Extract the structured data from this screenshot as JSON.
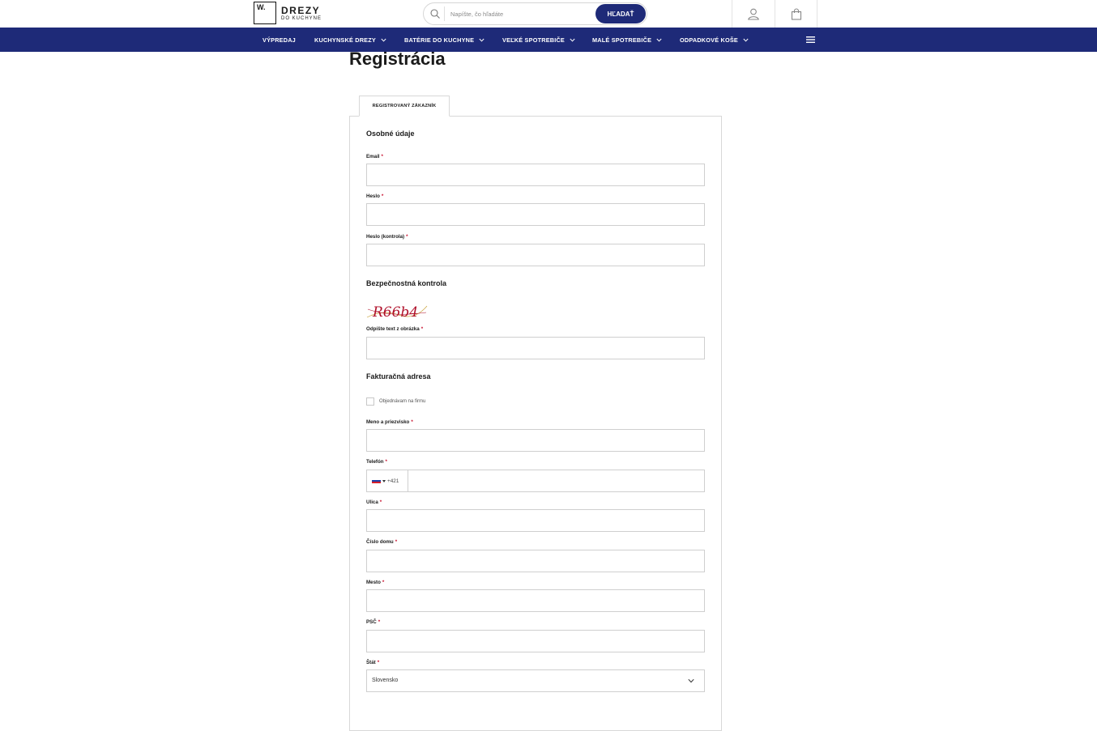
{
  "header": {
    "logo": {
      "mark": "W.",
      "main": "DREZY",
      "sub": "DO KUCHYNE"
    },
    "search": {
      "placeholder": "Napíšte, čo hľadáte",
      "button": "HĽADAŤ"
    },
    "icons": {
      "account": "user-icon",
      "cart": "shopping-bag-icon"
    }
  },
  "nav": {
    "items": [
      {
        "label": "VÝPREDAJ",
        "dropdown": false
      },
      {
        "label": "KUCHYNSKÉ DREZY",
        "dropdown": true
      },
      {
        "label": "BATÉRIE DO KUCHYNE",
        "dropdown": true
      },
      {
        "label": "VEĽKÉ SPOTREBIČE",
        "dropdown": true
      },
      {
        "label": "MALÉ SPOTREBIČE",
        "dropdown": true
      },
      {
        "label": "ODPADKOVÉ KOŠE",
        "dropdown": true
      }
    ],
    "menu_icon": "hamburger-icon",
    "bg_color": "#1e2a78"
  },
  "page": {
    "title": "Registrácia"
  },
  "form": {
    "tab": "REGISTROVANÝ ZÁKAZNÍK",
    "required_mark": "*",
    "personal": {
      "title": "Osobné údaje",
      "email": "Email",
      "password": "Heslo",
      "password_confirm": "Heslo (kontrola)"
    },
    "security": {
      "title": "Bezpečnostná kontrola",
      "captcha_text": "R66b4",
      "captcha_label": "Odpíšte text z obrázka"
    },
    "billing": {
      "title": "Fakturačná adresa",
      "company_checkbox": "Objednávam na firmu",
      "name": "Meno a priezvisko",
      "phone": "Telefón",
      "phone_prefix": "+421",
      "street": "Ulica",
      "house_number": "Číslo domu",
      "city": "Mesto",
      "zip": "PSČ",
      "country": "Štát",
      "country_value": "Slovensko"
    }
  },
  "colors": {
    "accent": "#1e2a78",
    "required": "#c8102e",
    "captcha": "#b0102a"
  }
}
